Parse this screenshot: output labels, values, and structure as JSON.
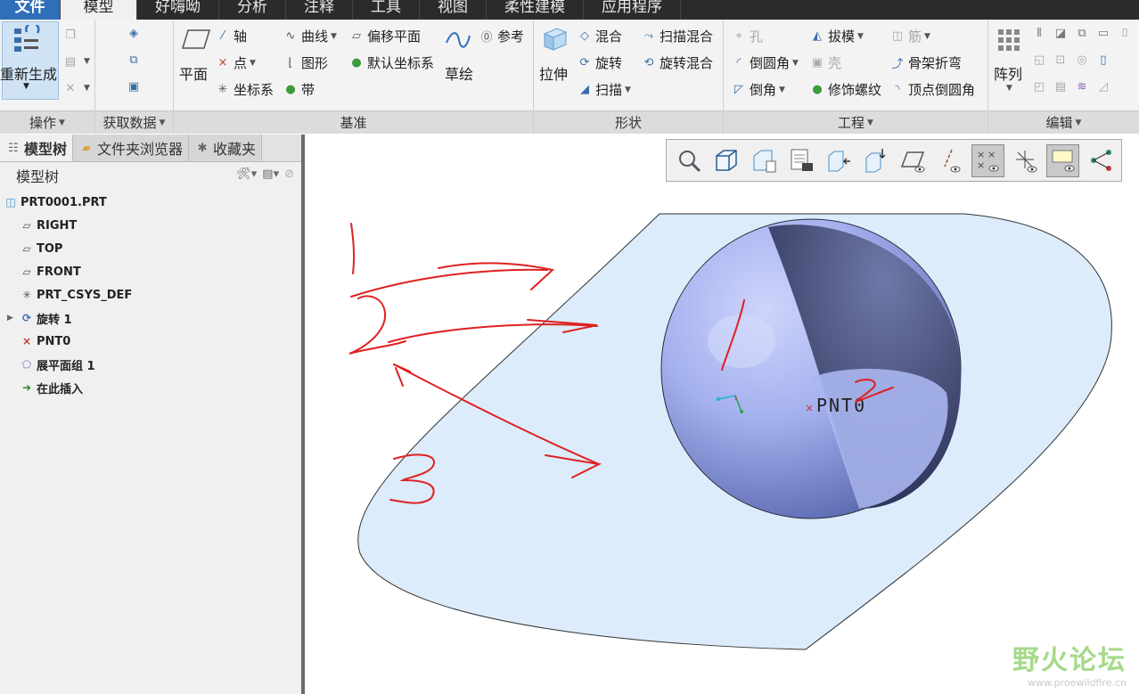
{
  "menubar": {
    "tabs": [
      "文件",
      "模型",
      "好嗨呦",
      "分析",
      "注释",
      "工具",
      "视图",
      "柔性建模",
      "应用程序"
    ]
  },
  "ribbon": {
    "operations": {
      "regenerate": "重新生成",
      "label": "操作"
    },
    "get_data": {
      "label": "获取数据"
    },
    "datum": {
      "plane": "平面",
      "axis": "轴",
      "point": "点",
      "csys": "坐标系",
      "curve": "曲线",
      "graph": "图形",
      "ribbon": "带",
      "offset_plane": "偏移平面",
      "default_csys": "默认坐标系",
      "sketch": "草绘",
      "reference": "参考",
      "label": "基准"
    },
    "shapes": {
      "extrude": "拉伸",
      "blend": "混合",
      "revolve": "旋转",
      "sweep": "扫描",
      "swept_blend": "扫描混合",
      "rotational_blend": "旋转混合",
      "label": "形状"
    },
    "engineering": {
      "hole": "孔",
      "round": "倒圆角",
      "chamfer": "倒角",
      "draft": "拔模",
      "shell": "壳",
      "cosmetic_thread": "修饰螺纹",
      "rib": "筋",
      "spinal_bend": "骨架折弯",
      "vertex_round": "顶点倒圆角",
      "label": "工程"
    },
    "editing": {
      "pattern": "阵列",
      "label": "编辑"
    }
  },
  "panel": {
    "tabs": [
      "模型树",
      "文件夹浏览器",
      "收藏夹"
    ],
    "header": "模型树",
    "tree": [
      {
        "label": "PRT0001.PRT",
        "icon": "part-icon"
      },
      {
        "label": "RIGHT",
        "icon": "datum-plane-icon"
      },
      {
        "label": "TOP",
        "icon": "datum-plane-icon"
      },
      {
        "label": "FRONT",
        "icon": "datum-plane-icon"
      },
      {
        "label": "PRT_CSYS_DEF",
        "icon": "csys-icon"
      },
      {
        "label": "旋转 1",
        "icon": "revolve-icon"
      },
      {
        "label": "PNT0",
        "icon": "datum-point-icon"
      },
      {
        "label": "展平面组 1",
        "icon": "flatten-quilt-icon"
      },
      {
        "label": "在此插入",
        "icon": "insert-here-icon"
      }
    ]
  },
  "graphics": {
    "point_label": "PNT0",
    "annotations": [
      "1",
      "2",
      "3"
    ]
  },
  "watermark": {
    "title": "野火论坛",
    "url": "www.proewildfire.cn"
  },
  "colors": {
    "file_tab": "#2f6fba",
    "quilt_fill": "#dcecfa",
    "sphere_light": "#a9b6f0",
    "sphere_dark": "#3a4468",
    "annotation_red": "#e02020"
  }
}
